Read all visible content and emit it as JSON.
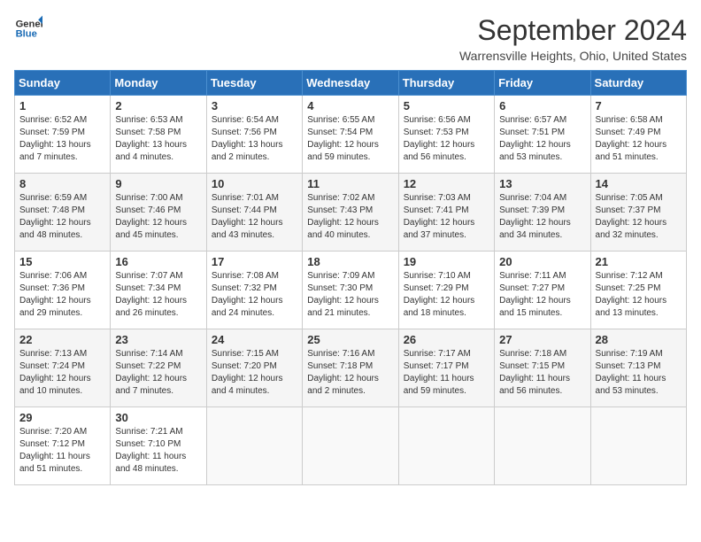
{
  "header": {
    "logo_line1": "General",
    "logo_line2": "Blue",
    "month": "September 2024",
    "location": "Warrensville Heights, Ohio, United States"
  },
  "days_of_week": [
    "Sunday",
    "Monday",
    "Tuesday",
    "Wednesday",
    "Thursday",
    "Friday",
    "Saturday"
  ],
  "weeks": [
    [
      {
        "day": "1",
        "sunrise": "6:52 AM",
        "sunset": "7:59 PM",
        "daylight": "13 hours and 7 minutes."
      },
      {
        "day": "2",
        "sunrise": "6:53 AM",
        "sunset": "7:58 PM",
        "daylight": "13 hours and 4 minutes."
      },
      {
        "day": "3",
        "sunrise": "6:54 AM",
        "sunset": "7:56 PM",
        "daylight": "13 hours and 2 minutes."
      },
      {
        "day": "4",
        "sunrise": "6:55 AM",
        "sunset": "7:54 PM",
        "daylight": "12 hours and 59 minutes."
      },
      {
        "day": "5",
        "sunrise": "6:56 AM",
        "sunset": "7:53 PM",
        "daylight": "12 hours and 56 minutes."
      },
      {
        "day": "6",
        "sunrise": "6:57 AM",
        "sunset": "7:51 PM",
        "daylight": "12 hours and 53 minutes."
      },
      {
        "day": "7",
        "sunrise": "6:58 AM",
        "sunset": "7:49 PM",
        "daylight": "12 hours and 51 minutes."
      }
    ],
    [
      {
        "day": "8",
        "sunrise": "6:59 AM",
        "sunset": "7:48 PM",
        "daylight": "12 hours and 48 minutes."
      },
      {
        "day": "9",
        "sunrise": "7:00 AM",
        "sunset": "7:46 PM",
        "daylight": "12 hours and 45 minutes."
      },
      {
        "day": "10",
        "sunrise": "7:01 AM",
        "sunset": "7:44 PM",
        "daylight": "12 hours and 43 minutes."
      },
      {
        "day": "11",
        "sunrise": "7:02 AM",
        "sunset": "7:43 PM",
        "daylight": "12 hours and 40 minutes."
      },
      {
        "day": "12",
        "sunrise": "7:03 AM",
        "sunset": "7:41 PM",
        "daylight": "12 hours and 37 minutes."
      },
      {
        "day": "13",
        "sunrise": "7:04 AM",
        "sunset": "7:39 PM",
        "daylight": "12 hours and 34 minutes."
      },
      {
        "day": "14",
        "sunrise": "7:05 AM",
        "sunset": "7:37 PM",
        "daylight": "12 hours and 32 minutes."
      }
    ],
    [
      {
        "day": "15",
        "sunrise": "7:06 AM",
        "sunset": "7:36 PM",
        "daylight": "12 hours and 29 minutes."
      },
      {
        "day": "16",
        "sunrise": "7:07 AM",
        "sunset": "7:34 PM",
        "daylight": "12 hours and 26 minutes."
      },
      {
        "day": "17",
        "sunrise": "7:08 AM",
        "sunset": "7:32 PM",
        "daylight": "12 hours and 24 minutes."
      },
      {
        "day": "18",
        "sunrise": "7:09 AM",
        "sunset": "7:30 PM",
        "daylight": "12 hours and 21 minutes."
      },
      {
        "day": "19",
        "sunrise": "7:10 AM",
        "sunset": "7:29 PM",
        "daylight": "12 hours and 18 minutes."
      },
      {
        "day": "20",
        "sunrise": "7:11 AM",
        "sunset": "7:27 PM",
        "daylight": "12 hours and 15 minutes."
      },
      {
        "day": "21",
        "sunrise": "7:12 AM",
        "sunset": "7:25 PM",
        "daylight": "12 hours and 13 minutes."
      }
    ],
    [
      {
        "day": "22",
        "sunrise": "7:13 AM",
        "sunset": "7:24 PM",
        "daylight": "12 hours and 10 minutes."
      },
      {
        "day": "23",
        "sunrise": "7:14 AM",
        "sunset": "7:22 PM",
        "daylight": "12 hours and 7 minutes."
      },
      {
        "day": "24",
        "sunrise": "7:15 AM",
        "sunset": "7:20 PM",
        "daylight": "12 hours and 4 minutes."
      },
      {
        "day": "25",
        "sunrise": "7:16 AM",
        "sunset": "7:18 PM",
        "daylight": "12 hours and 2 minutes."
      },
      {
        "day": "26",
        "sunrise": "7:17 AM",
        "sunset": "7:17 PM",
        "daylight": "11 hours and 59 minutes."
      },
      {
        "day": "27",
        "sunrise": "7:18 AM",
        "sunset": "7:15 PM",
        "daylight": "11 hours and 56 minutes."
      },
      {
        "day": "28",
        "sunrise": "7:19 AM",
        "sunset": "7:13 PM",
        "daylight": "11 hours and 53 minutes."
      }
    ],
    [
      {
        "day": "29",
        "sunrise": "7:20 AM",
        "sunset": "7:12 PM",
        "daylight": "11 hours and 51 minutes."
      },
      {
        "day": "30",
        "sunrise": "7:21 AM",
        "sunset": "7:10 PM",
        "daylight": "11 hours and 48 minutes."
      },
      null,
      null,
      null,
      null,
      null
    ]
  ]
}
